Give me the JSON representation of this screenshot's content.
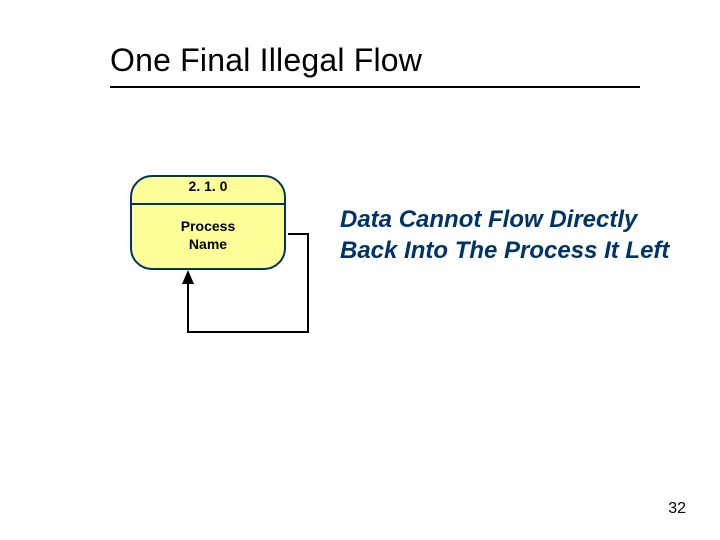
{
  "slide": {
    "title": "One Final Illegal Flow",
    "page_number": "32"
  },
  "process": {
    "id": "2. 1. 0",
    "name": "Process\nName"
  },
  "rule_text": "Data Cannot Flow Directly Back Into The Process It Left"
}
